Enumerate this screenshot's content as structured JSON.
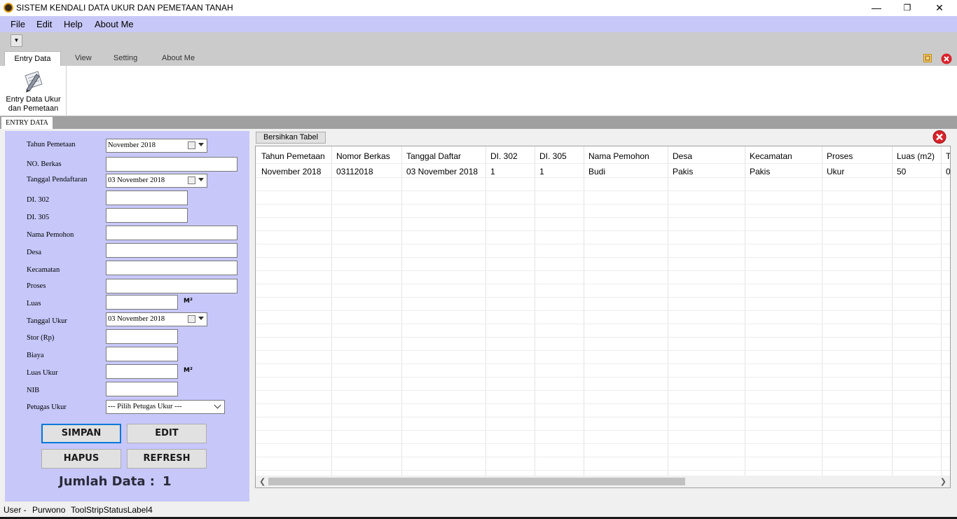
{
  "window": {
    "title": "SISTEM KENDALI DATA UKUR DAN PEMETAAN TANAH",
    "minimize": "—",
    "maximize": "❐",
    "close": "✕"
  },
  "menu": [
    "File",
    "Edit",
    "Help",
    "About Me"
  ],
  "quick_access": {
    "dropdown": "▼"
  },
  "ribbon": {
    "tabs": [
      "Entry Data",
      "View",
      "Setting",
      "About Me"
    ],
    "active_tab": "Entry Data",
    "button_label_line1": "Entry Data Ukur",
    "button_label_line2": "dan Pemetaan"
  },
  "doc_tab": "ENTRY DATA",
  "form": {
    "labels": {
      "tahun_pemetaan": "Tahun Pemetaan",
      "no_berkas": "NO. Berkas",
      "tanggal_pendaftaran": "Tanggal Pendaftaran",
      "di302": "DI. 302",
      "di305": "DI. 305",
      "nama_pemohon": "Nama Pemohon",
      "desa": "Desa",
      "kecamatan": "Kecamatan",
      "proses": "Proses",
      "luas": "Luas",
      "tanggal_ukur": "Tanggal Ukur",
      "stor": "Stor (Rp)",
      "biaya": "Biaya",
      "luas_ukur": "Luas Ukur",
      "nib": "NIB",
      "petugas_ukur": "Petugas Ukur"
    },
    "values": {
      "tahun_pemetaan": "November 2018",
      "tanggal_pendaftaran": "03 November 2018",
      "tanggal_ukur": "03 November 2018",
      "petugas_ukur": "--- Pilih Petugas Ukur ---"
    },
    "unit_m2": "M²",
    "buttons": {
      "simpan": "SIMPAN",
      "edit": "EDIT",
      "hapus": "HAPUS",
      "refresh": "REFRESH"
    },
    "jumlah_label": "Jumlah Data :",
    "jumlah_value": "1"
  },
  "grid": {
    "clear_button": "Bersihkan Tabel",
    "columns": [
      "Tahun Pemetaan",
      "Nomor Berkas",
      "Tanggal Daftar",
      "DI. 302",
      "DI. 305",
      "Nama Pemohon",
      "Desa",
      "Kecamatan",
      "Proses",
      "Luas (m2)",
      "T"
    ],
    "rows": [
      [
        "November 2018",
        "03112018",
        "03 November 2018",
        "1",
        "1",
        "Budi",
        "Pakis",
        "Pakis",
        "Ukur",
        "50",
        "0"
      ]
    ]
  },
  "status": {
    "user_label": "User  -",
    "user_name": "Purwono",
    "label4": "ToolStripStatusLabel4"
  },
  "colors": {
    "accent_panel": "#c7c7fa",
    "menubar": "#c8c8f8",
    "close_red": "#d9232b",
    "focus_blue": "#0078d7"
  }
}
